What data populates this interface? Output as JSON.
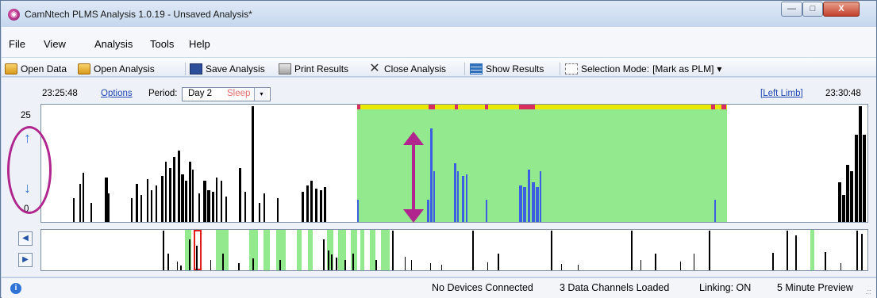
{
  "window": {
    "title": "CamNtech PLMS Analysis 1.0.19 - Unsaved Analysis*",
    "controls": {
      "minimize": "—",
      "maximize": "□",
      "close": "X"
    }
  },
  "menu": {
    "file": "File",
    "view": "View",
    "analysis": "Analysis",
    "tools": "Tools",
    "help": "Help"
  },
  "toolbar": {
    "open_data": "Open Data",
    "open_analysis": "Open Analysis",
    "save_analysis": "Save Analysis",
    "print_results": "Print Results",
    "close_analysis": "Close Analysis",
    "show_results": "Show Results",
    "selection_mode_label": "Selection Mode:",
    "selection_mode_value": "[Mark as PLM]",
    "selection_mode_arrow": "▾"
  },
  "controls": {
    "start_time": "23:25:48",
    "options": "Options",
    "period_label": "Period:",
    "period_day": "Day 2",
    "period_stage": "Sleep",
    "dropdown_arrow": "▾",
    "limb": "[Left Limb]",
    "end_time": "23:30:48"
  },
  "chart": {
    "y_max": "25",
    "y_min": "0",
    "up_icon": "↑",
    "down_icon": "↓",
    "left_nav": "◀",
    "right_nav": "▶",
    "colors": {
      "activity": "#000000",
      "plm": "#3b5fe0",
      "sleep": "#93e98d",
      "marker": "#e8e800",
      "highlight": "#d92d5d"
    }
  },
  "status": {
    "info_icon": "i",
    "devices": "No Devices Connected",
    "channels": "3 Data Channels Loaded",
    "linking": "Linking: ON",
    "preview": "5 Minute Preview",
    "resize": ".::"
  }
}
